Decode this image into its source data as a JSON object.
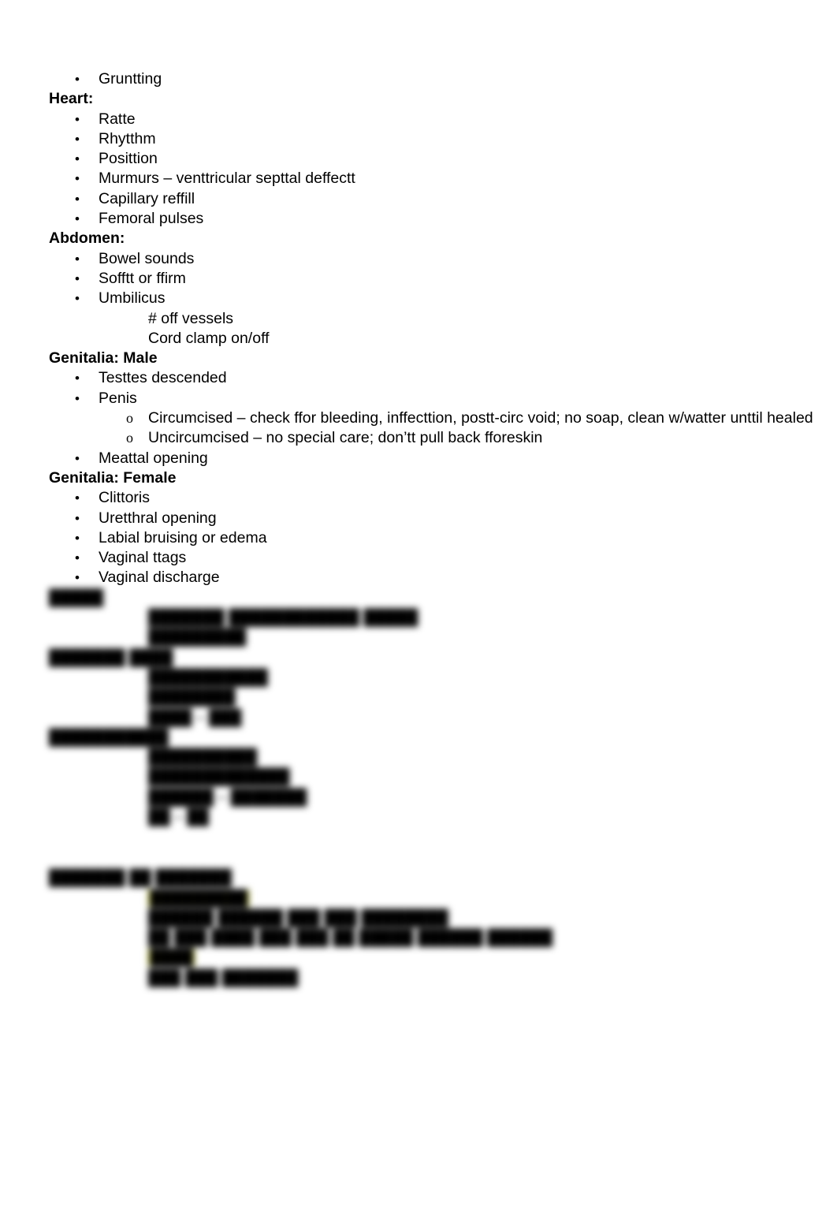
{
  "document": {
    "sections": [
      {
        "id": "respiratory-continued",
        "heading": null,
        "items": [
          {
            "type": "bullet",
            "marker": "•",
            "text": "Gruntting"
          }
        ]
      },
      {
        "id": "heart",
        "heading": "Heart:",
        "items": [
          {
            "type": "bullet",
            "marker": "•",
            "text": "Ratte"
          },
          {
            "type": "bullet",
            "marker": "•",
            "text": "Rhytthm"
          },
          {
            "type": "bullet",
            "marker": "•",
            "text": "Posittion"
          },
          {
            "type": "bullet",
            "marker": "•",
            "text": "Murmurs – venttricular septtal deffectt"
          },
          {
            "type": "bullet",
            "marker": "•",
            "text": "Capillary reffill"
          },
          {
            "type": "bullet",
            "marker": "•",
            "text": "Femoral pulses"
          }
        ]
      },
      {
        "id": "abdomen",
        "heading": "Abdomen:",
        "items": [
          {
            "type": "bullet",
            "marker": "•",
            "text": "Bowel sounds"
          },
          {
            "type": "bullet",
            "marker": "•",
            "text": "Sofftt or ffirm"
          },
          {
            "type": "bullet",
            "marker": "•",
            "text": "Umbilicus"
          },
          {
            "type": "plain",
            "marker": "",
            "text": "# off vessels"
          },
          {
            "type": "plain",
            "marker": "",
            "text": "Cord clamp on/off"
          }
        ]
      },
      {
        "id": "genitalia-male",
        "heading": "Genitalia: Male",
        "items": [
          {
            "type": "bullet",
            "marker": "•",
            "text": "Testtes descended"
          },
          {
            "type": "bullet",
            "marker": "•",
            "text": "Penis"
          },
          {
            "type": "sub",
            "marker": "o",
            "text": "Circumcised – check ffor bleeding, inffecttion, postt-circ void; no soap, clean w/watter unttil healed"
          },
          {
            "type": "sub",
            "marker": "o",
            "text": "Uncircumcised – no special care; don’tt pull back fforeskin"
          },
          {
            "type": "bullet",
            "marker": "•",
            "text": "Meattal opening"
          }
        ]
      },
      {
        "id": "genitalia-female",
        "heading": "Genitalia: Female",
        "items": [
          {
            "type": "bullet",
            "marker": "•",
            "text": "Clittoris"
          },
          {
            "type": "bullet",
            "marker": "•",
            "text": "Uretthral opening"
          },
          {
            "type": "bullet",
            "marker": "•",
            "text": "Labial bruising or edema"
          },
          {
            "type": "bullet",
            "marker": "•",
            "text": "Vaginal ttags"
          },
          {
            "type": "bullet",
            "marker": "•",
            "text": "Vaginal discharge"
          }
        ]
      }
    ],
    "redacted": {
      "note": "lower portion of page is blurred and illegible",
      "blocks": [
        {
          "id": "redacted-block-1",
          "heading": "█████",
          "lines": [
            {
              "indent": "sub",
              "text": "███████   ████████████ █████"
            },
            {
              "indent": "sub",
              "text": "█████████"
            }
          ]
        },
        {
          "id": "redacted-block-2",
          "heading": "███████  ████",
          "lines": [
            {
              "indent": "sub",
              "text": "███████████"
            },
            {
              "indent": "sub",
              "text": "████████"
            },
            {
              "indent": "sub",
              "text": "████ – ███"
            }
          ]
        },
        {
          "id": "redacted-block-3",
          "heading": "███████████",
          "lines": [
            {
              "indent": "sub",
              "text": "██████████"
            },
            {
              "indent": "sub",
              "text": "█████████████"
            },
            {
              "indent": "sub",
              "text": "██████ – ███████"
            },
            {
              "indent": "sub",
              "text": "██ – ██"
            }
          ]
        },
        {
          "id": "redacted-block-4",
          "heading": "███████ ██ ███████",
          "lines": [
            {
              "indent": "sub",
              "highlight": true,
              "text": "█████████"
            },
            {
              "indent": "sub2",
              "text": "██████ ██████ ███ ███ ████████"
            },
            {
              "indent": "sub2",
              "text": "██ ███ ████ ███ ███ ██ █████ ██████ ██████"
            },
            {
              "indent": "sub",
              "highlight": true,
              "text": "████"
            },
            {
              "indent": "sub2",
              "text": "███ ███ ███████"
            }
          ]
        }
      ]
    }
  },
  "colors": {
    "highlight": "#d9d916",
    "text": "#000000",
    "page_background": "#ffffff"
  }
}
